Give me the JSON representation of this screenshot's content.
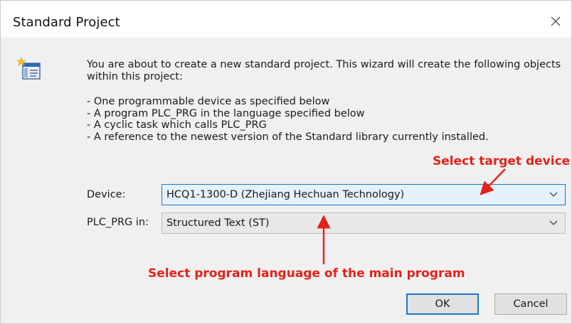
{
  "dialog": {
    "title": "Standard Project",
    "close_icon": "close-icon"
  },
  "intro": {
    "text": "You are about to create a new standard project. This wizard will create the following objects within this project:"
  },
  "bullets": [
    "- One programmable device as specified below",
    "- A program PLC_PRG in the language specified below",
    "- A cyclic task which calls PLC_PRG",
    "- A reference to the newest version of the Standard library currently installed."
  ],
  "device": {
    "label": "Device:",
    "value": "HCQ1-1300-D (Zhejiang Hechuan Technology)"
  },
  "plc_prg": {
    "label": "PLC_PRG in:",
    "value": "Structured Text (ST)"
  },
  "annotations": {
    "target_device": "Select target device",
    "program_language": "Select program language of the main program"
  },
  "buttons": {
    "ok": "OK",
    "cancel": "Cancel"
  },
  "colors": {
    "annotation": "#e3221a",
    "focus": "#1979ca"
  }
}
